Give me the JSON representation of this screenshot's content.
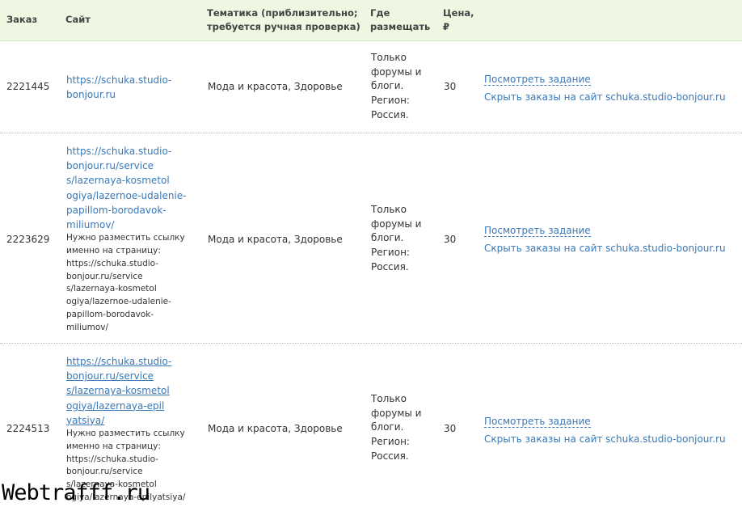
{
  "headers": {
    "order": "Заказ",
    "site": "Сайт",
    "theme": "Тематика (приблизительно;\nтребуется ручная проверка)",
    "where": "Где\nразмещать",
    "price": "Цена,\n₽"
  },
  "rows": [
    {
      "order": "2221445",
      "site_link": "https://schuka.studio-\nbonjour.ru",
      "note": "",
      "theme": "Мода и красота, Здоровье",
      "where": "Только\nфорумы и\nблоги.\nРегион:\nРоссия.",
      "price": "30",
      "view_label": "Посмотреть задание",
      "hide_label": "Скрыть заказы на сайт schuka.studio-bonjour.ru"
    },
    {
      "order": "2223629",
      "site_link": "https://schuka.studio-\nbonjour.ru/service\ns/lazernaya-kosmetol\nogiya/lazernoe-udalenie-\npapillom-borodavok-\nmiliumov/",
      "note": "Нужно разместить ссылку\nименно на страницу:\nhttps://schuka.studio-\nbonjour.ru/service\ns/lazernaya-kosmetol\nogiya/lazernoe-udalenie-\npapillom-borodavok-\nmiliumov/",
      "theme": "Мода и красота, Здоровье",
      "where": "Только\nфорумы и\nблоги.\nРегион:\nРоссия.",
      "price": "30",
      "view_label": "Посмотреть задание",
      "hide_label": "Скрыть заказы на сайт schuka.studio-bonjour.ru"
    },
    {
      "order": "2224513",
      "site_link": "https://schuka.studio-\nbonjour.ru/service\ns/lazernaya-kosmetol\nogiya/lazernaya-epil\nyatsiya/",
      "note": "Нужно разместить ссылку\nименно на страницу:\nhttps://schuka.studio-\nbonjour.ru/service\ns/lazernaya-kosmetol\nogiya/lazernaya-epilyatsiya/",
      "theme": "Мода и красота, Здоровье",
      "where": "Только\nфорумы и\nблоги.\nРегион:\nРоссия.",
      "price": "30",
      "view_label": "Посмотреть задание",
      "hide_label": "Скрыть заказы на сайт schuka.studio-bonjour.ru"
    }
  ],
  "watermark": "Webtrafff.ru",
  "colors": {
    "header_bg": "#eef7e2",
    "link": "#3978b6"
  }
}
